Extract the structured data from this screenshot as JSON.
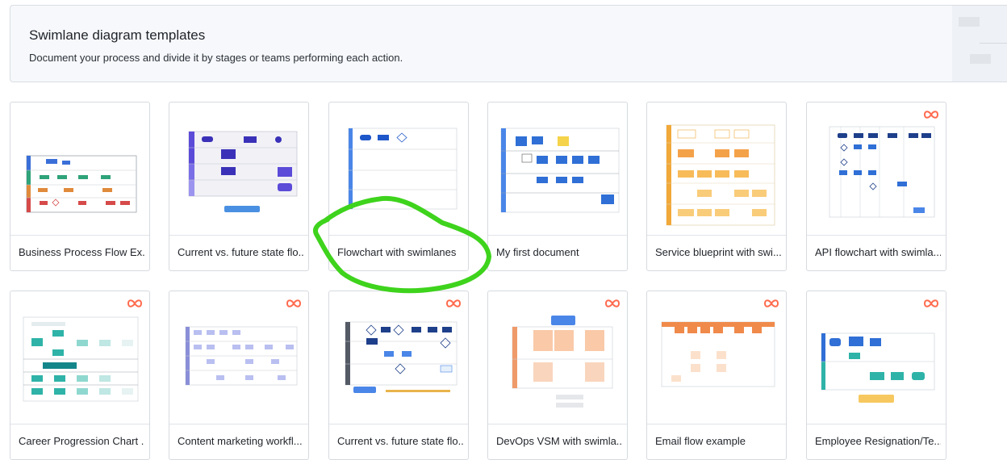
{
  "banner": {
    "title": "Swimlane diagram templates",
    "subtitle": "Document your process and divide it by stages or teams performing each action."
  },
  "templates": [
    {
      "label": "Business Process Flow Ex...",
      "has_brand_icon": false
    },
    {
      "label": "Current vs. future state flo...",
      "has_brand_icon": false
    },
    {
      "label": "Flowchart with swimlanes",
      "has_brand_icon": false
    },
    {
      "label": "My first document",
      "has_brand_icon": false
    },
    {
      "label": "Service blueprint with swi...",
      "has_brand_icon": false
    },
    {
      "label": "API flowchart with swimla...",
      "has_brand_icon": true
    },
    {
      "label": "Career Progression Chart ...",
      "has_brand_icon": true
    },
    {
      "label": "Content marketing workfl...",
      "has_brand_icon": true
    },
    {
      "label": "Current vs. future state flo...",
      "has_brand_icon": true
    },
    {
      "label": "DevOps VSM with swimla...",
      "has_brand_icon": true
    },
    {
      "label": "Email flow example",
      "has_brand_icon": true
    },
    {
      "label": "Employee Resignation/Te...",
      "has_brand_icon": true
    }
  ],
  "annotation": {
    "color": "#3ed31c",
    "icon": "hand-drawn-circle"
  },
  "colors": {
    "brand_icon": "#ff6a4d",
    "accent_blue": "#1e57c9"
  }
}
